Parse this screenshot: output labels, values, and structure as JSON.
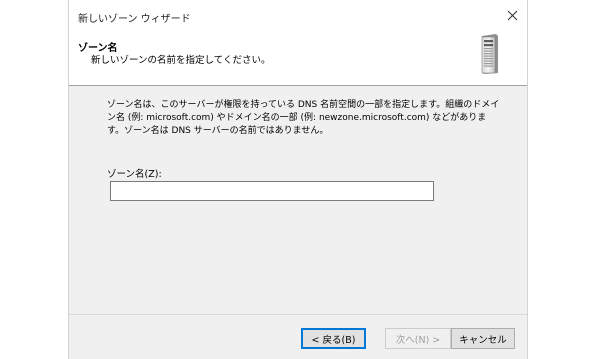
{
  "window": {
    "title": "新しいゾーン ウィザード",
    "close_icon": "close-icon"
  },
  "header": {
    "title": "ゾーン名",
    "subtitle": "新しいゾーンの名前を指定してください。",
    "icon": "server-tower-icon"
  },
  "body": {
    "description": "ゾーン名は、このサーバーが権限を持っている DNS 名前空間の一部を指定します。組織のドメイン名 (例: microsoft.com) やドメイン名の一部 (例: newzone.microsoft.com) などがあります。ゾーン名は DNS サーバーの名前ではありません。",
    "zone_name_label": "ゾーン名(Z):",
    "zone_name_value": ""
  },
  "buttons": {
    "back": "< 戻る(B)",
    "next": "次へ(N) >",
    "cancel": "キャンセル"
  },
  "colors": {
    "focus_accent": "#0078d7",
    "dialog_background": "#f0f0f0",
    "disabled_text": "#a0a0a0"
  }
}
